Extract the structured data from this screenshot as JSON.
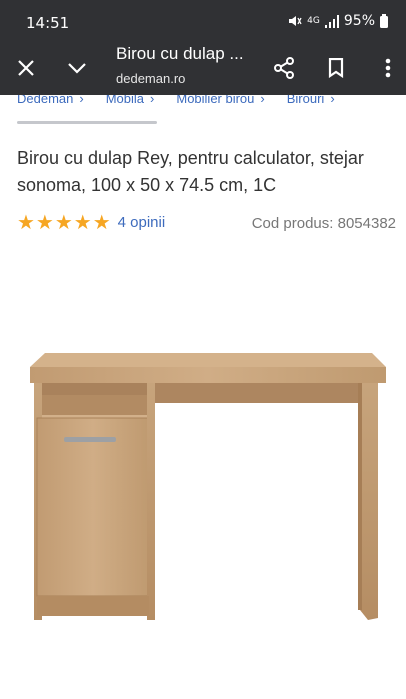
{
  "status_bar": {
    "time": "14:51",
    "battery": "95%",
    "network": "4G"
  },
  "browser": {
    "title": "Birou cu dulap ...",
    "url": "dedeman.ro"
  },
  "breadcrumbs": [
    "Dedeman",
    "Mobila",
    "Mobilier birou",
    "Birouri"
  ],
  "product": {
    "title": "Birou cu dulap Rey, pentru calculator, stejar sonoma, 100 x 50 x 74.5 cm, 1C",
    "stars": "★★★★★",
    "rating_value": 5,
    "reviews": "4 opinii",
    "code": "Cod produs: 8054382"
  },
  "colors": {
    "topbar": "#303134",
    "link": "#3d6bbd",
    "star": "#f6a623",
    "wood": "#c9a57c"
  },
  "icons": [
    "close-icon",
    "chevron-down-icon",
    "share-icon",
    "bookmark-icon",
    "more-vert-icon"
  ]
}
